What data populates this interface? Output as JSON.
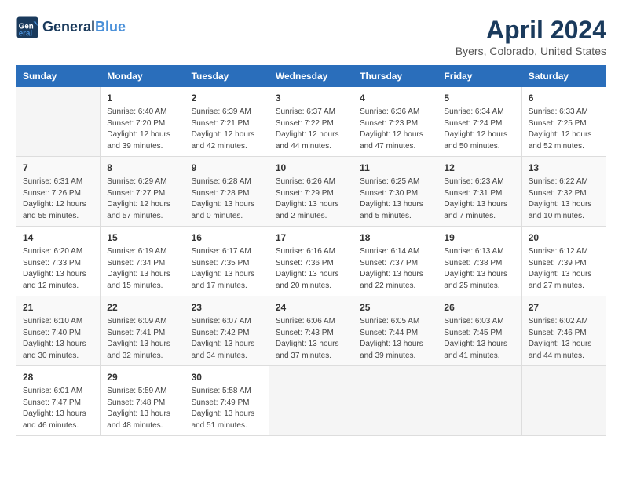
{
  "header": {
    "logo_line1": "General",
    "logo_line2": "Blue",
    "title": "April 2024",
    "location": "Byers, Colorado, United States"
  },
  "days_of_week": [
    "Sunday",
    "Monday",
    "Tuesday",
    "Wednesday",
    "Thursday",
    "Friday",
    "Saturday"
  ],
  "weeks": [
    [
      {
        "day": "",
        "sunrise": "",
        "sunset": "",
        "daylight": ""
      },
      {
        "day": "1",
        "sunrise": "Sunrise: 6:40 AM",
        "sunset": "Sunset: 7:20 PM",
        "daylight": "Daylight: 12 hours and 39 minutes."
      },
      {
        "day": "2",
        "sunrise": "Sunrise: 6:39 AM",
        "sunset": "Sunset: 7:21 PM",
        "daylight": "Daylight: 12 hours and 42 minutes."
      },
      {
        "day": "3",
        "sunrise": "Sunrise: 6:37 AM",
        "sunset": "Sunset: 7:22 PM",
        "daylight": "Daylight: 12 hours and 44 minutes."
      },
      {
        "day": "4",
        "sunrise": "Sunrise: 6:36 AM",
        "sunset": "Sunset: 7:23 PM",
        "daylight": "Daylight: 12 hours and 47 minutes."
      },
      {
        "day": "5",
        "sunrise": "Sunrise: 6:34 AM",
        "sunset": "Sunset: 7:24 PM",
        "daylight": "Daylight: 12 hours and 50 minutes."
      },
      {
        "day": "6",
        "sunrise": "Sunrise: 6:33 AM",
        "sunset": "Sunset: 7:25 PM",
        "daylight": "Daylight: 12 hours and 52 minutes."
      }
    ],
    [
      {
        "day": "7",
        "sunrise": "Sunrise: 6:31 AM",
        "sunset": "Sunset: 7:26 PM",
        "daylight": "Daylight: 12 hours and 55 minutes."
      },
      {
        "day": "8",
        "sunrise": "Sunrise: 6:29 AM",
        "sunset": "Sunset: 7:27 PM",
        "daylight": "Daylight: 12 hours and 57 minutes."
      },
      {
        "day": "9",
        "sunrise": "Sunrise: 6:28 AM",
        "sunset": "Sunset: 7:28 PM",
        "daylight": "Daylight: 13 hours and 0 minutes."
      },
      {
        "day": "10",
        "sunrise": "Sunrise: 6:26 AM",
        "sunset": "Sunset: 7:29 PM",
        "daylight": "Daylight: 13 hours and 2 minutes."
      },
      {
        "day": "11",
        "sunrise": "Sunrise: 6:25 AM",
        "sunset": "Sunset: 7:30 PM",
        "daylight": "Daylight: 13 hours and 5 minutes."
      },
      {
        "day": "12",
        "sunrise": "Sunrise: 6:23 AM",
        "sunset": "Sunset: 7:31 PM",
        "daylight": "Daylight: 13 hours and 7 minutes."
      },
      {
        "day": "13",
        "sunrise": "Sunrise: 6:22 AM",
        "sunset": "Sunset: 7:32 PM",
        "daylight": "Daylight: 13 hours and 10 minutes."
      }
    ],
    [
      {
        "day": "14",
        "sunrise": "Sunrise: 6:20 AM",
        "sunset": "Sunset: 7:33 PM",
        "daylight": "Daylight: 13 hours and 12 minutes."
      },
      {
        "day": "15",
        "sunrise": "Sunrise: 6:19 AM",
        "sunset": "Sunset: 7:34 PM",
        "daylight": "Daylight: 13 hours and 15 minutes."
      },
      {
        "day": "16",
        "sunrise": "Sunrise: 6:17 AM",
        "sunset": "Sunset: 7:35 PM",
        "daylight": "Daylight: 13 hours and 17 minutes."
      },
      {
        "day": "17",
        "sunrise": "Sunrise: 6:16 AM",
        "sunset": "Sunset: 7:36 PM",
        "daylight": "Daylight: 13 hours and 20 minutes."
      },
      {
        "day": "18",
        "sunrise": "Sunrise: 6:14 AM",
        "sunset": "Sunset: 7:37 PM",
        "daylight": "Daylight: 13 hours and 22 minutes."
      },
      {
        "day": "19",
        "sunrise": "Sunrise: 6:13 AM",
        "sunset": "Sunset: 7:38 PM",
        "daylight": "Daylight: 13 hours and 25 minutes."
      },
      {
        "day": "20",
        "sunrise": "Sunrise: 6:12 AM",
        "sunset": "Sunset: 7:39 PM",
        "daylight": "Daylight: 13 hours and 27 minutes."
      }
    ],
    [
      {
        "day": "21",
        "sunrise": "Sunrise: 6:10 AM",
        "sunset": "Sunset: 7:40 PM",
        "daylight": "Daylight: 13 hours and 30 minutes."
      },
      {
        "day": "22",
        "sunrise": "Sunrise: 6:09 AM",
        "sunset": "Sunset: 7:41 PM",
        "daylight": "Daylight: 13 hours and 32 minutes."
      },
      {
        "day": "23",
        "sunrise": "Sunrise: 6:07 AM",
        "sunset": "Sunset: 7:42 PM",
        "daylight": "Daylight: 13 hours and 34 minutes."
      },
      {
        "day": "24",
        "sunrise": "Sunrise: 6:06 AM",
        "sunset": "Sunset: 7:43 PM",
        "daylight": "Daylight: 13 hours and 37 minutes."
      },
      {
        "day": "25",
        "sunrise": "Sunrise: 6:05 AM",
        "sunset": "Sunset: 7:44 PM",
        "daylight": "Daylight: 13 hours and 39 minutes."
      },
      {
        "day": "26",
        "sunrise": "Sunrise: 6:03 AM",
        "sunset": "Sunset: 7:45 PM",
        "daylight": "Daylight: 13 hours and 41 minutes."
      },
      {
        "day": "27",
        "sunrise": "Sunrise: 6:02 AM",
        "sunset": "Sunset: 7:46 PM",
        "daylight": "Daylight: 13 hours and 44 minutes."
      }
    ],
    [
      {
        "day": "28",
        "sunrise": "Sunrise: 6:01 AM",
        "sunset": "Sunset: 7:47 PM",
        "daylight": "Daylight: 13 hours and 46 minutes."
      },
      {
        "day": "29",
        "sunrise": "Sunrise: 5:59 AM",
        "sunset": "Sunset: 7:48 PM",
        "daylight": "Daylight: 13 hours and 48 minutes."
      },
      {
        "day": "30",
        "sunrise": "Sunrise: 5:58 AM",
        "sunset": "Sunset: 7:49 PM",
        "daylight": "Daylight: 13 hours and 51 minutes."
      },
      {
        "day": "",
        "sunrise": "",
        "sunset": "",
        "daylight": ""
      },
      {
        "day": "",
        "sunrise": "",
        "sunset": "",
        "daylight": ""
      },
      {
        "day": "",
        "sunrise": "",
        "sunset": "",
        "daylight": ""
      },
      {
        "day": "",
        "sunrise": "",
        "sunset": "",
        "daylight": ""
      }
    ]
  ]
}
